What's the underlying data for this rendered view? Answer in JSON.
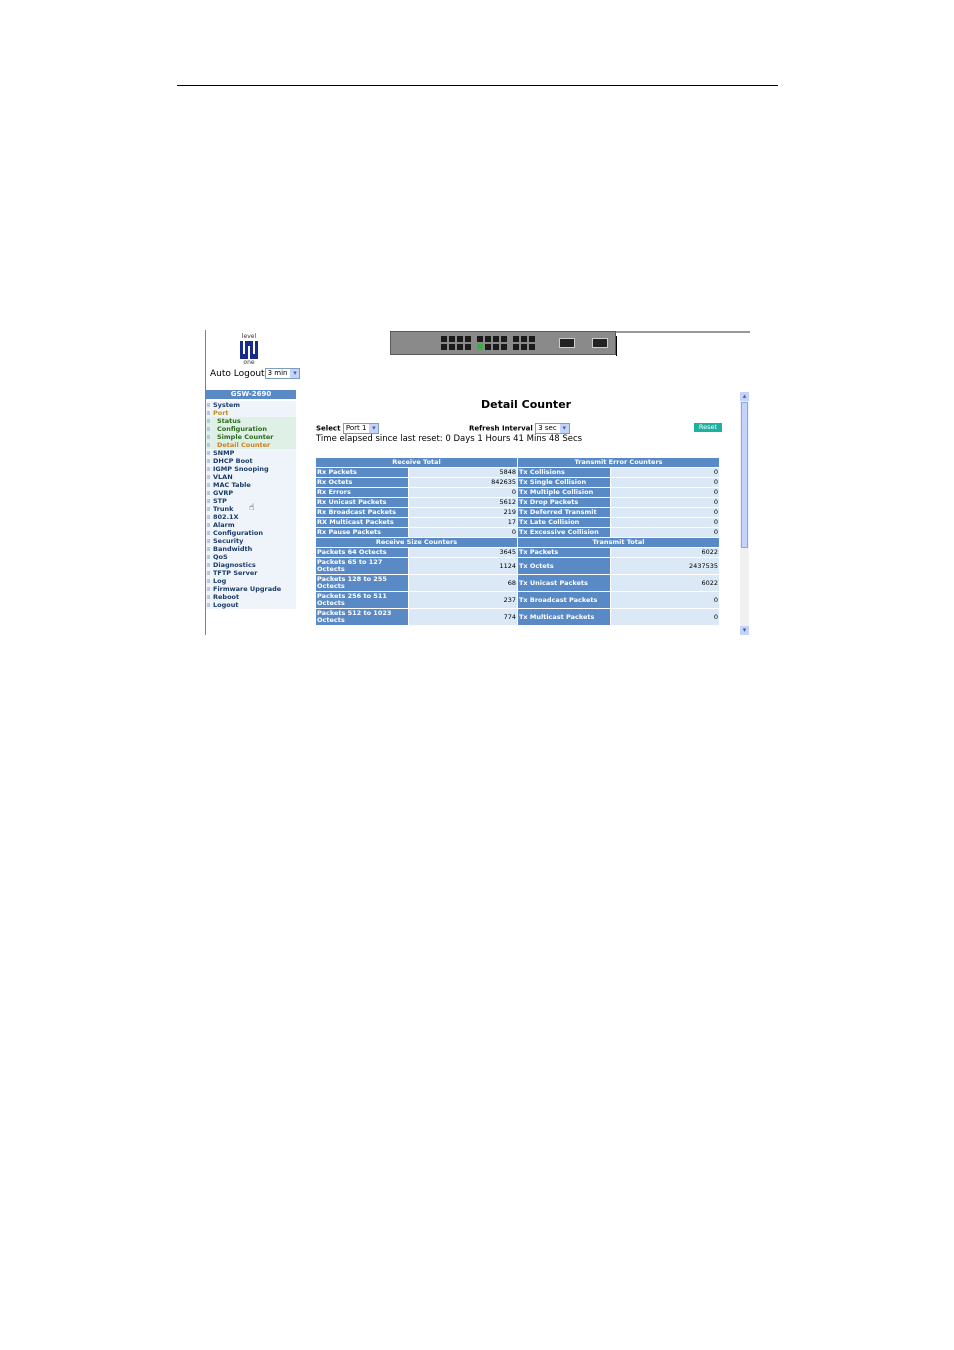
{
  "header": {
    "logo_top": "level",
    "logo_bottom": "one",
    "auto_logout_label": "Auto Logout",
    "auto_logout_value": "3 min"
  },
  "sidebar": {
    "title": "GSW-2690",
    "items": [
      {
        "label": "System"
      },
      {
        "label": "Port"
      },
      {
        "label": "Status"
      },
      {
        "label": "Configuration"
      },
      {
        "label": "Simple Counter"
      },
      {
        "label": "Detail Counter"
      },
      {
        "label": "SNMP"
      },
      {
        "label": "DHCP Boot"
      },
      {
        "label": "IGMP Snooping"
      },
      {
        "label": "VLAN"
      },
      {
        "label": "MAC Table"
      },
      {
        "label": "GVRP"
      },
      {
        "label": "STP"
      },
      {
        "label": "Trunk"
      },
      {
        "label": "802.1X"
      },
      {
        "label": "Alarm"
      },
      {
        "label": "Configuration"
      },
      {
        "label": "Security"
      },
      {
        "label": "Bandwidth"
      },
      {
        "label": "QoS"
      },
      {
        "label": "Diagnostics"
      },
      {
        "label": "TFTP Server"
      },
      {
        "label": "Log"
      },
      {
        "label": "Firmware Upgrade"
      },
      {
        "label": "Reboot"
      },
      {
        "label": "Logout"
      }
    ]
  },
  "main": {
    "title": "Detail Counter",
    "select_label": "Select",
    "select_value": "Port 1",
    "refresh_label": "Refresh Interval",
    "refresh_value": "3 sec",
    "reset_label": "Reset",
    "elapsed": "Time elapsed since last reset: 0 Days 1 Hours 41 Mins 48 Secs",
    "sections": {
      "receive_total": "Receive Total",
      "transmit_error": "Transmit Error Counters",
      "receive_size": "Receive Size Counters",
      "transmit_total": "Transmit Total"
    },
    "rows": [
      {
        "l": "Rx Packets",
        "lv": "5848",
        "r": "Tx Collisions",
        "rv": "0"
      },
      {
        "l": "Rx Octets",
        "lv": "842635",
        "r": "Tx Single Collision",
        "rv": "0"
      },
      {
        "l": "Rx Errors",
        "lv": "0",
        "r": "Tx Multiple Collision",
        "rv": "0"
      },
      {
        "l": "Rx Unicast Packets",
        "lv": "5612",
        "r": "Tx Drop Packets",
        "rv": "0"
      },
      {
        "l": "Rx Broadcast Packets",
        "lv": "219",
        "r": "Tx Deferred Transmit",
        "rv": "0"
      },
      {
        "l": "RX Multicast Packets",
        "lv": "17",
        "r": "Tx Late Collision",
        "rv": "0"
      },
      {
        "l": "Rx Pause Packets",
        "lv": "0",
        "r": "Tx Excessive Collision",
        "rv": "0"
      }
    ],
    "rows2": [
      {
        "l": "Packets 64 Octects",
        "lv": "3645",
        "r": "Tx Packets",
        "rv": "6022"
      },
      {
        "l": "Packets 65 to 127 Octects",
        "lv": "1124",
        "r": "Tx Octets",
        "rv": "2437535"
      },
      {
        "l": "Packets 128 to 255 Octects",
        "lv": "68",
        "r": "Tx Unicast Packets",
        "rv": "6022"
      },
      {
        "l": "Packets 256 to 511 Octects",
        "lv": "237",
        "r": "Tx Broadcast Packets",
        "rv": "0"
      },
      {
        "l": "Packets 512 to 1023 Octects",
        "lv": "774",
        "r": "Tx Multicast Packets",
        "rv": "0"
      }
    ]
  }
}
